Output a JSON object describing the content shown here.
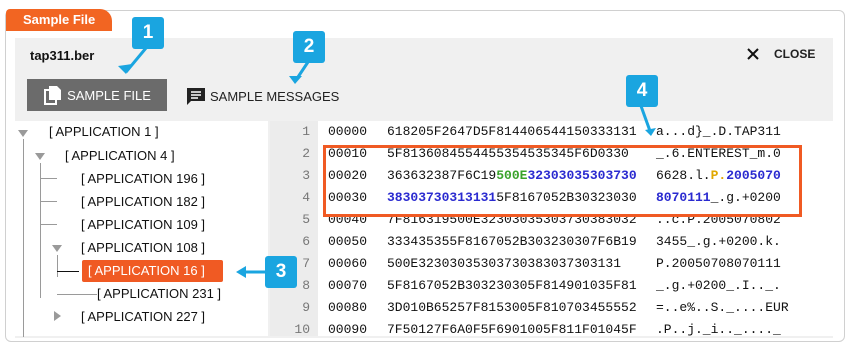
{
  "window": {
    "tab_label": "Sample File",
    "file_name": "tap311.ber",
    "close_label": "CLOSE"
  },
  "toolbar": {
    "sample_file_label": "SAMPLE FILE",
    "sample_messages_label": "SAMPLE MESSAGES"
  },
  "tree": [
    {
      "label": "[ APPLICATION 1 ]"
    },
    {
      "label": "[ APPLICATION 4 ]"
    },
    {
      "label": "[ APPLICATION 196 ]"
    },
    {
      "label": "[ APPLICATION 182 ]"
    },
    {
      "label": "[ APPLICATION 109 ]"
    },
    {
      "label": "[ APPLICATION 108 ]"
    },
    {
      "label": "[ APPLICATION 16 ]"
    },
    {
      "label": "[ APPLICATION 231 ]"
    },
    {
      "label": "[ APPLICATION 227 ]"
    }
  ],
  "hex_rows": [
    {
      "line": "1",
      "offset": "00000",
      "hex": [
        "618205F2647D5F814406544150333131"
      ],
      "ascii": [
        "a...d}_.D.TAP311"
      ]
    },
    {
      "line": "2",
      "offset": "00010",
      "hex": [
        "5F8136084554455354535345F6D0330"
      ],
      "ascii": [
        "_.6.ENTEREST_m.0"
      ]
    },
    {
      "line": "3",
      "offset": "00020",
      "hex": [
        "363632387F6C19",
        "500E",
        "32303035303730"
      ],
      "ascii": [
        "6628.l.",
        "P.",
        "2005070"
      ]
    },
    {
      "line": "4",
      "offset": "00030",
      "hex": [
        "38303730313131",
        "5F8167052B30323030"
      ],
      "ascii": [
        "8070111",
        "_.g.+0200"
      ]
    },
    {
      "line": "5",
      "offset": "00040",
      "hex": [
        "7F816319500E32303035303730383032"
      ],
      "ascii": [
        "..c.P.2005070802"
      ]
    },
    {
      "line": "6",
      "offset": "00050",
      "hex": [
        "333435355F8167052B303230307F6B19"
      ],
      "ascii": [
        "3455_.g.+0200.k."
      ]
    },
    {
      "line": "7",
      "offset": "00060",
      "hex": [
        "500E32303035303730383037303131"
      ],
      "ascii": [
        "P.20050708070111"
      ]
    },
    {
      "line": "8",
      "offset": "00070",
      "hex": [
        "5F8167052B303230305F814901035F81"
      ],
      "ascii": [
        "_.g.+0200_.I.._."
      ]
    },
    {
      "line": "9",
      "offset": "00080",
      "hex": [
        "3D010B65257F8153005F810703455552"
      ],
      "ascii": [
        "=..e%..S._....EUR"
      ]
    },
    {
      "line": "10",
      "offset": "00090",
      "hex": [
        "7F50127F6A0F5F6901005F811F01045F"
      ],
      "ascii": [
        ".P..j._i.._...._"
      ]
    }
  ],
  "callouts": [
    "1",
    "2",
    "3",
    "4"
  ],
  "colors": {
    "accent": "#f05a23",
    "callout": "#1aa5e0",
    "gold": "#e0a800",
    "green": "#3aa32b",
    "blue": "#2a2ad0"
  }
}
